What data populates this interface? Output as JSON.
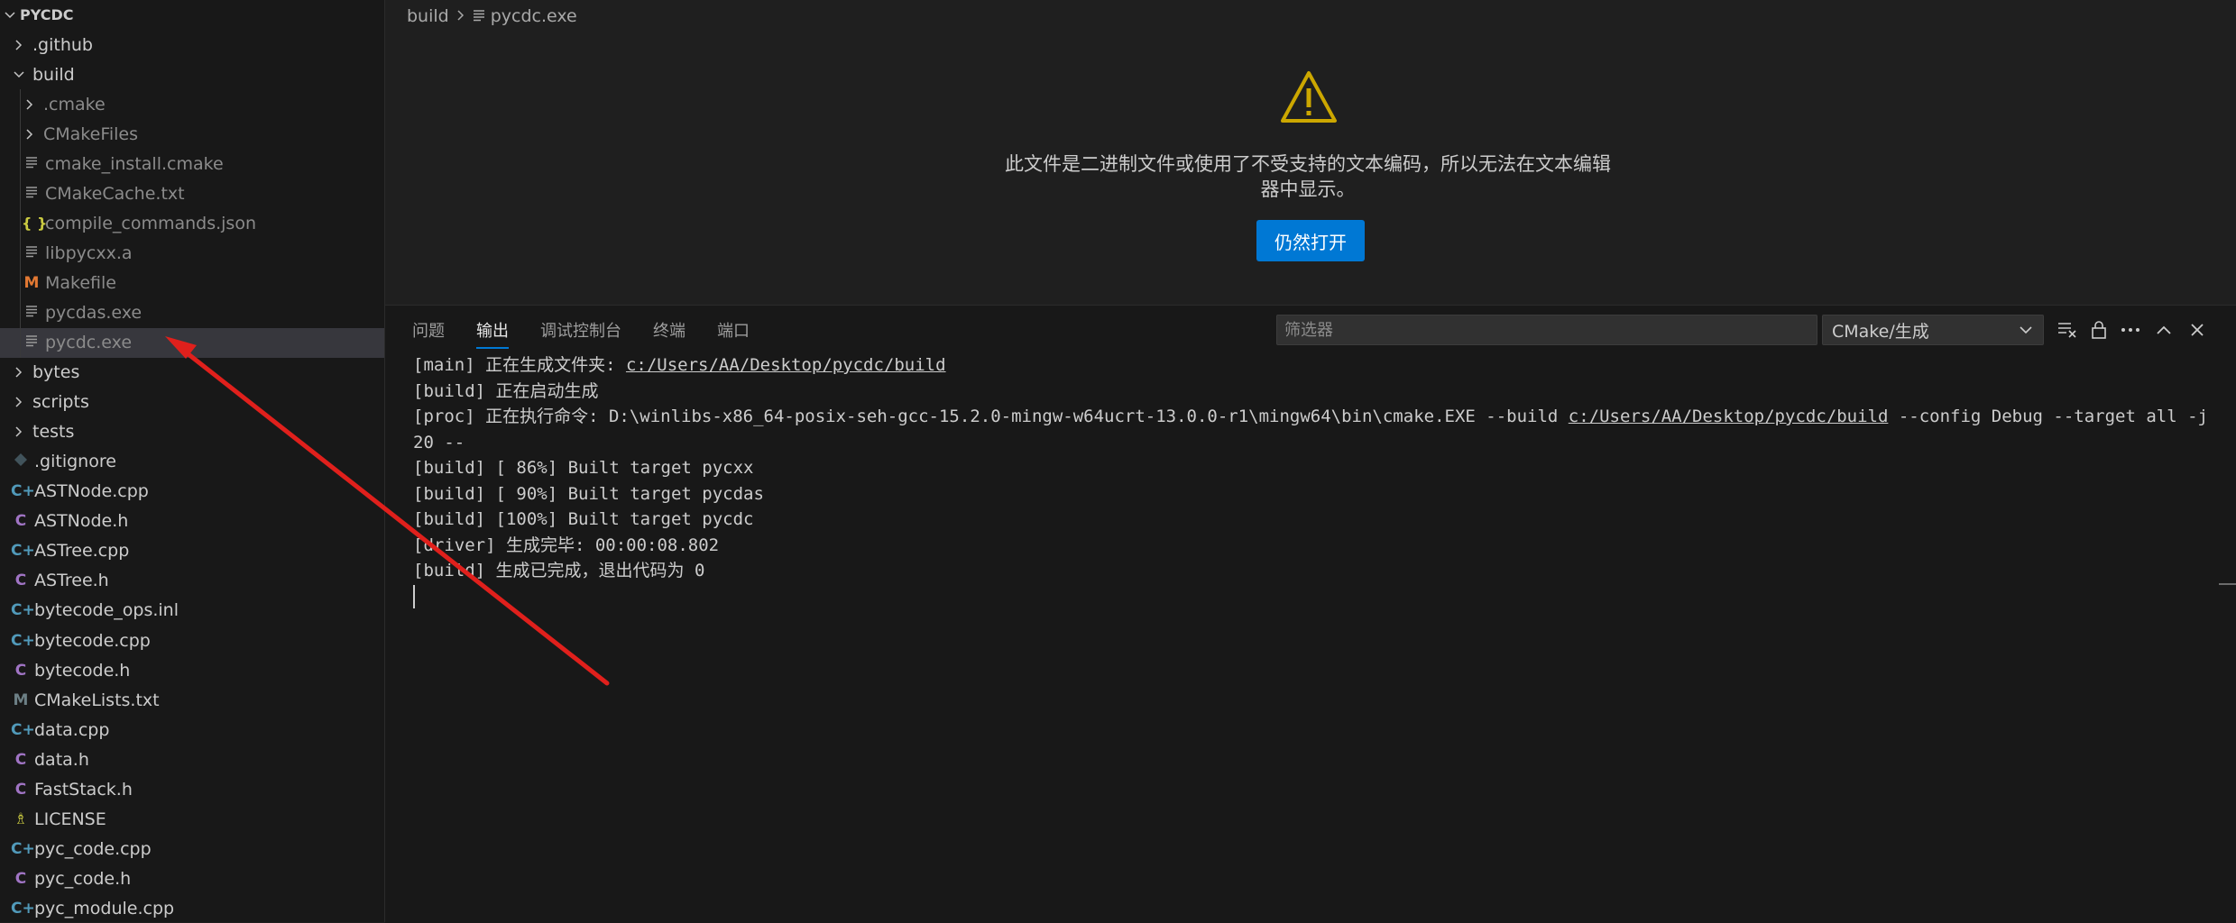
{
  "explorer": {
    "root": "PYCDC",
    "items": [
      {
        "label": ".github",
        "type": "folder",
        "expanded": false,
        "depth": 1
      },
      {
        "label": "build",
        "type": "folder",
        "expanded": true,
        "depth": 1
      },
      {
        "label": ".cmake",
        "type": "folder",
        "expanded": false,
        "depth": 2,
        "dim": true
      },
      {
        "label": "CMakeFiles",
        "type": "folder",
        "expanded": false,
        "depth": 2,
        "dim": true
      },
      {
        "label": "cmake_install.cmake",
        "type": "file",
        "icon": "lines",
        "depth": 2,
        "dim": true
      },
      {
        "label": "CMakeCache.txt",
        "type": "file",
        "icon": "lines",
        "depth": 2,
        "dim": true
      },
      {
        "label": "compile_commands.json",
        "type": "file",
        "icon": "json",
        "depth": 2,
        "dim": true
      },
      {
        "label": "libpycxx.a",
        "type": "file",
        "icon": "lines",
        "depth": 2,
        "dim": true
      },
      {
        "label": "Makefile",
        "type": "file",
        "icon": "m",
        "depth": 2,
        "dim": true
      },
      {
        "label": "pycdas.exe",
        "type": "file",
        "icon": "lines",
        "depth": 2,
        "dim": true
      },
      {
        "label": "pycdc.exe",
        "type": "file",
        "icon": "lines",
        "depth": 2,
        "dim": true,
        "selected": true
      },
      {
        "label": "bytes",
        "type": "folder",
        "expanded": false,
        "depth": 1
      },
      {
        "label": "scripts",
        "type": "folder",
        "expanded": false,
        "depth": 1
      },
      {
        "label": "tests",
        "type": "folder",
        "expanded": false,
        "depth": 1
      },
      {
        "label": ".gitignore",
        "type": "file",
        "icon": "git",
        "depth": 1
      },
      {
        "label": "ASTNode.cpp",
        "type": "file",
        "icon": "cpp",
        "depth": 1
      },
      {
        "label": "ASTNode.h",
        "type": "file",
        "icon": "h",
        "depth": 1
      },
      {
        "label": "ASTree.cpp",
        "type": "file",
        "icon": "cpp",
        "depth": 1
      },
      {
        "label": "ASTree.h",
        "type": "file",
        "icon": "h",
        "depth": 1
      },
      {
        "label": "bytecode_ops.inl",
        "type": "file",
        "icon": "cpp",
        "depth": 1
      },
      {
        "label": "bytecode.cpp",
        "type": "file",
        "icon": "cpp",
        "depth": 1
      },
      {
        "label": "bytecode.h",
        "type": "file",
        "icon": "h",
        "depth": 1
      },
      {
        "label": "CMakeLists.txt",
        "type": "file",
        "icon": "cm",
        "depth": 1
      },
      {
        "label": "data.cpp",
        "type": "file",
        "icon": "cpp",
        "depth": 1
      },
      {
        "label": "data.h",
        "type": "file",
        "icon": "h",
        "depth": 1
      },
      {
        "label": "FastStack.h",
        "type": "file",
        "icon": "h",
        "depth": 1
      },
      {
        "label": "LICENSE",
        "type": "file",
        "icon": "lic",
        "depth": 1
      },
      {
        "label": "pyc_code.cpp",
        "type": "file",
        "icon": "cpp",
        "depth": 1
      },
      {
        "label": "pyc_code.h",
        "type": "file",
        "icon": "h",
        "depth": 1
      },
      {
        "label": "pyc_module.cpp",
        "type": "file",
        "icon": "cpp",
        "depth": 1
      }
    ]
  },
  "editor": {
    "breadcrumb": [
      "build",
      "pycdc.exe"
    ],
    "message": "此文件是二进制文件或使用了不受支持的文本编码，所以无法在文本编辑器中显示。",
    "open_anyway_label": "仍然打开"
  },
  "panel": {
    "tabs": [
      {
        "label": "问题",
        "active": false
      },
      {
        "label": "输出",
        "active": true
      },
      {
        "label": "调试控制台",
        "active": false
      },
      {
        "label": "终端",
        "active": false
      },
      {
        "label": "端口",
        "active": false
      }
    ],
    "filter_placeholder": "筛选器",
    "channel": "CMake/生成",
    "output_lines": [
      {
        "prefix": "[main] 正在生成文件夹: ",
        "link": "c:/Users/AA/Desktop/pycdc/build",
        "suffix": ""
      },
      {
        "prefix": "[build] 正在启动生成",
        "link": "",
        "suffix": ""
      },
      {
        "prefix": "[proc] 正在执行命令: D:\\winlibs-x86_64-posix-seh-gcc-15.2.0-mingw-w64ucrt-13.0.0-r1\\mingw64\\bin\\cmake.EXE --build ",
        "link": "c:/Users/AA/Desktop/pycdc/build",
        "suffix": " --config Debug --target all -j 20 --"
      },
      {
        "prefix": "[build] [ 86%] Built target pycxx",
        "link": "",
        "suffix": ""
      },
      {
        "prefix": "[build] [ 90%] Built target pycdas",
        "link": "",
        "suffix": ""
      },
      {
        "prefix": "[build] [100%] Built target pycdc",
        "link": "",
        "suffix": ""
      },
      {
        "prefix": "[driver] 生成完毕: 00:00:08.802",
        "link": "",
        "suffix": ""
      },
      {
        "prefix": "[build] 生成已完成，退出代码为 0",
        "link": "",
        "suffix": ""
      }
    ]
  },
  "colors": {
    "accent": "#0078d4",
    "warning": "#cca700",
    "annotation_arrow": "#e0201c"
  }
}
